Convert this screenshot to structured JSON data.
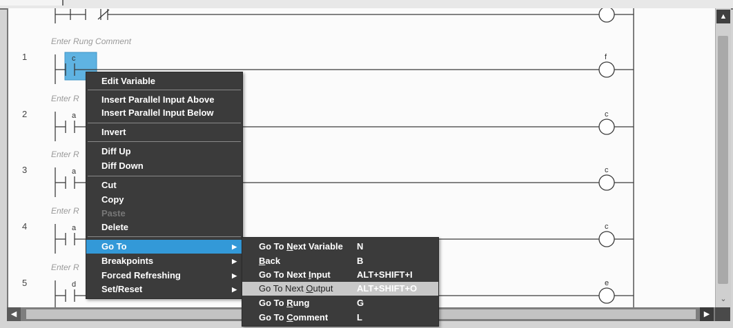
{
  "rungs": [
    {
      "number": "1",
      "comment": "Enter Rung Comment",
      "contact_var": "c",
      "coil_var": "f"
    },
    {
      "number": "2",
      "comment": "Enter R",
      "contact_var": "a",
      "coil_var": "c"
    },
    {
      "number": "3",
      "comment": "Enter R",
      "contact_var": "a",
      "coil_var": "c"
    },
    {
      "number": "4",
      "comment": "Enter R",
      "contact_var": "a",
      "coil_var": "c"
    },
    {
      "number": "5",
      "comment": "Enter R",
      "contact_var": "d",
      "coil_var": "e"
    }
  ],
  "context_menu": {
    "edit_variable": "Edit Variable",
    "insert_parallel_above": "Insert Parallel Input Above",
    "insert_parallel_below": "Insert Parallel Input Below",
    "invert": "Invert",
    "diff_up": "Diff Up",
    "diff_down": "Diff Down",
    "cut": "Cut",
    "copy": "Copy",
    "paste": "Paste",
    "delete": "Delete",
    "go_to": "Go To",
    "breakpoints": "Breakpoints",
    "forced_refreshing": "Forced Refreshing",
    "set_reset": "Set/Reset",
    "disabled_items": [
      "Paste"
    ],
    "highlighted_item": "Go To"
  },
  "goto_submenu": {
    "items": [
      {
        "pre": "Go To ",
        "u": "N",
        "post": "ext Variable",
        "shortcut": "N"
      },
      {
        "pre": "",
        "u": "B",
        "post": "ack",
        "shortcut": "B"
      },
      {
        "pre": "Go To Next ",
        "u": "I",
        "post": "nput",
        "shortcut": "ALT+SHIFT+I"
      },
      {
        "pre": "Go To Next ",
        "u": "O",
        "post": "utput",
        "shortcut": "ALT+SHIFT+O"
      },
      {
        "pre": "Go To ",
        "u": "R",
        "post": "ung",
        "shortcut": "G"
      },
      {
        "pre": "Go To ",
        "u": "C",
        "post": "omment",
        "shortcut": "L"
      }
    ],
    "hovered_item": "Go To Next Output"
  },
  "colors": {
    "menu_bg": "#3b3b3b",
    "menu_highlight": "#3399d8",
    "selection": "#5fb3e2",
    "submenu_hover": "#c8c8c8"
  },
  "icons": {
    "scroll_up": "triangle-up",
    "scroll_down": "chevron-down",
    "scroll_left": "triangle-left",
    "scroll_right": "triangle-right",
    "submenu_arrow": "triangle-right"
  }
}
